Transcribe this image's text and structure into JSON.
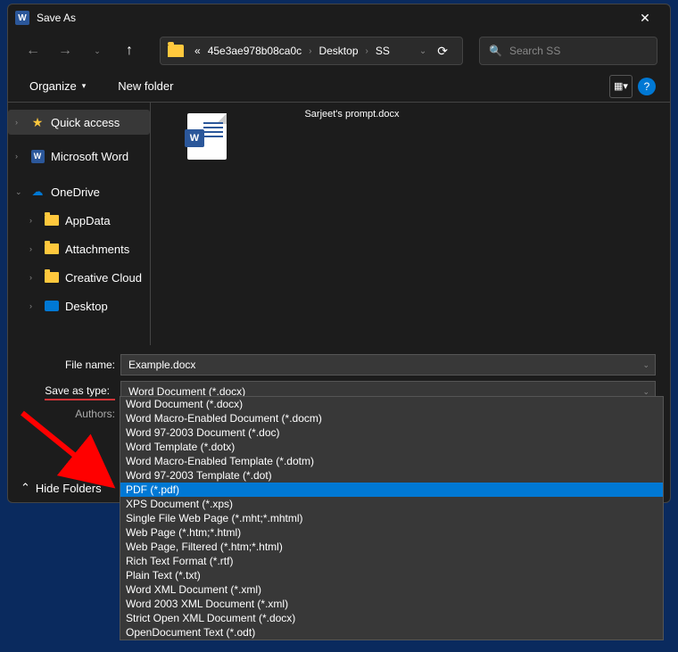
{
  "title": "Save As",
  "breadcrumbs": {
    "pre": "«",
    "p1": "45e3ae978b08ca0c",
    "p2": "Desktop",
    "p3": "SS"
  },
  "search": {
    "placeholder": "Search SS"
  },
  "toolbar": {
    "organize": "Organize",
    "newfolder": "New folder"
  },
  "sidebar": {
    "quick": "Quick access",
    "word": "Microsoft Word",
    "onedrive": "OneDrive",
    "appdata": "AppData",
    "attachments": "Attachments",
    "creative": "Creative Cloud",
    "desktop": "Desktop"
  },
  "file": {
    "name": "Sarjeet's prompt.docx"
  },
  "fields": {
    "filename_label": "File name:",
    "filename_value": "Example.docx",
    "savetype_label": "Save as type:",
    "savetype_value": "Word Document (*.docx)",
    "authors_label": "Authors:"
  },
  "savetype_options": [
    "Word Document (*.docx)",
    "Word Macro-Enabled Document (*.docm)",
    "Word 97-2003 Document (*.doc)",
    "Word Template (*.dotx)",
    "Word Macro-Enabled Template (*.dotm)",
    "Word 97-2003 Template (*.dot)",
    "PDF (*.pdf)",
    "XPS Document (*.xps)",
    "Single File Web Page (*.mht;*.mhtml)",
    "Web Page (*.htm;*.html)",
    "Web Page, Filtered (*.htm;*.html)",
    "Rich Text Format (*.rtf)",
    "Plain Text (*.txt)",
    "Word XML Document (*.xml)",
    "Word 2003 XML Document (*.xml)",
    "Strict Open XML Document (*.docx)",
    "OpenDocument Text (*.odt)"
  ],
  "savetype_selected_index": 6,
  "hide_folders": "Hide Folders"
}
